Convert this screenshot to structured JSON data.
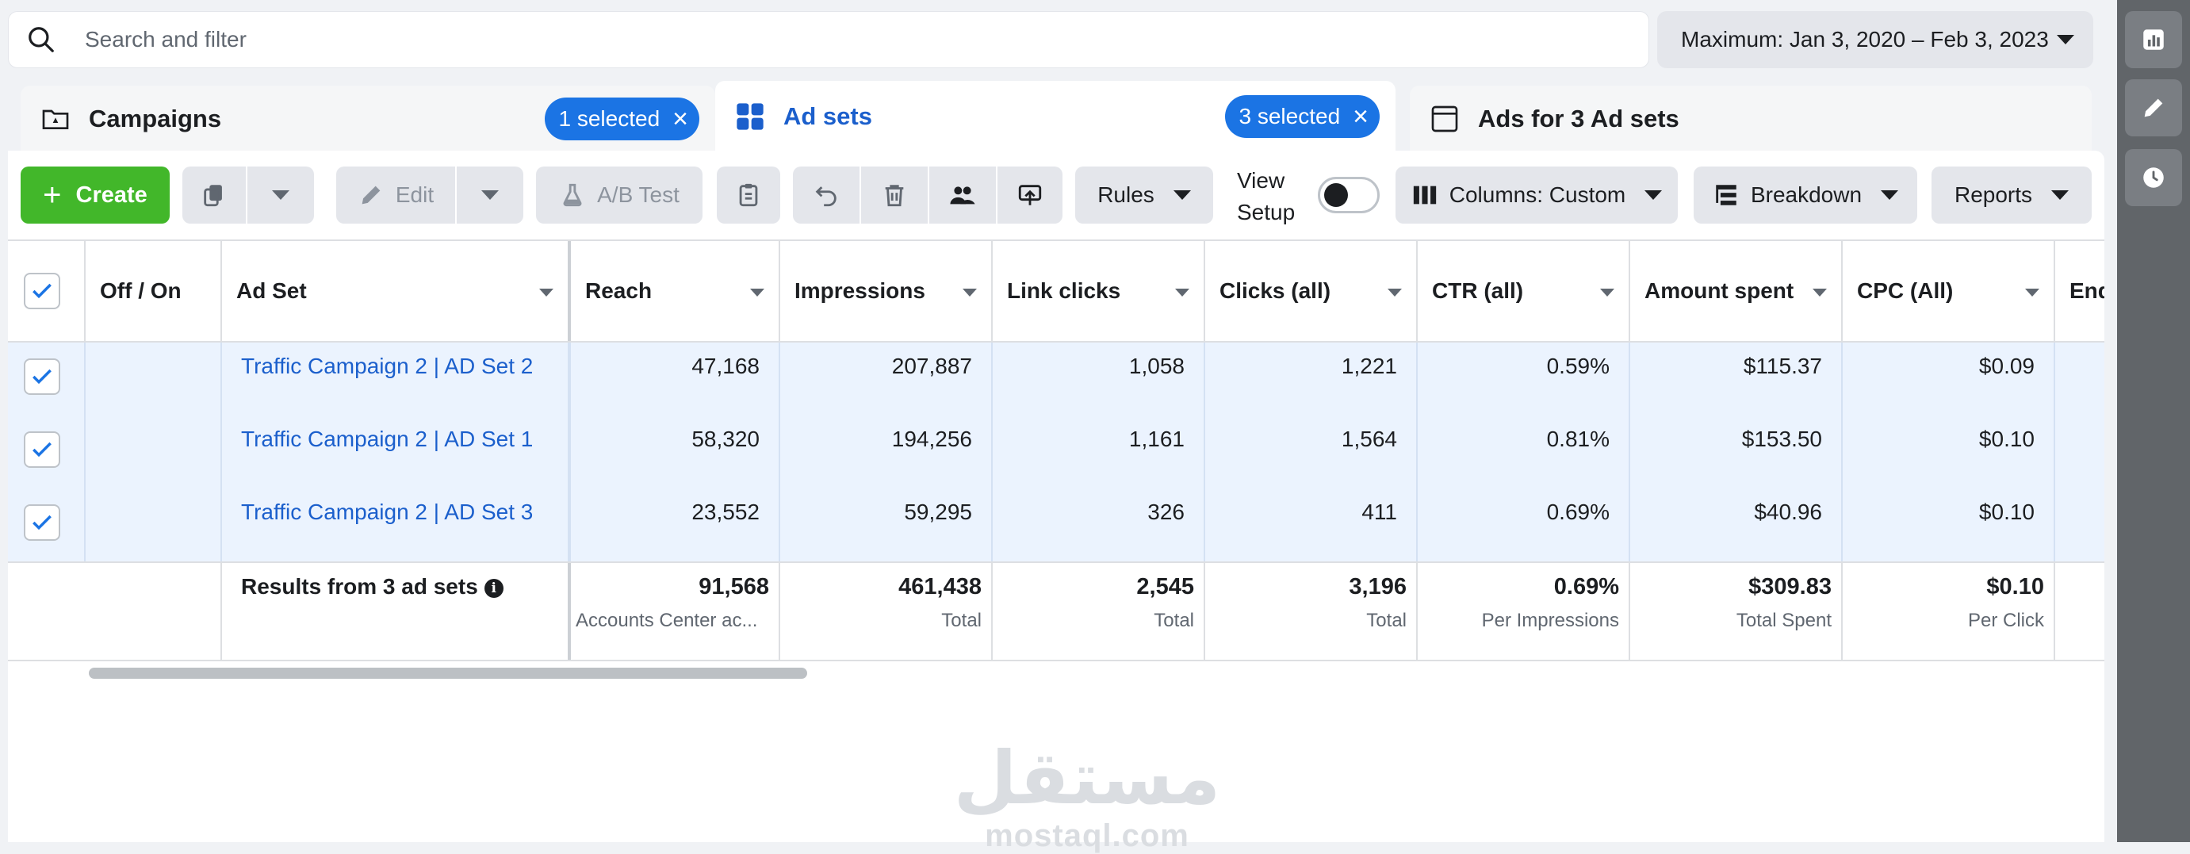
{
  "search": {
    "placeholder": "Search and filter"
  },
  "date_range": {
    "label": "Maximum: Jan 3, 2020 – Feb 3, 2023"
  },
  "tabs": [
    {
      "label": "Campaigns",
      "selected": "1 selected"
    },
    {
      "label": "Ad sets",
      "selected": "3 selected"
    },
    {
      "label": "Ads for 3 Ad sets"
    }
  ],
  "toolbar": {
    "create": "Create",
    "edit": "Edit",
    "ab_test": "A/B Test",
    "rules": "Rules",
    "view_setup_line1": "View",
    "view_setup_line2": "Setup",
    "columns": "Columns: Custom",
    "breakdown": "Breakdown",
    "reports": "Reports"
  },
  "table": {
    "columns": [
      "Off / On",
      "Ad Set",
      "Reach",
      "Impressions",
      "Link clicks",
      "Clicks (all)",
      "CTR (all)",
      "Amount spent",
      "CPC (All)",
      "Ends"
    ],
    "rows": [
      {
        "name": "Traffic Campaign 2 | AD Set 2",
        "reach": "47,168",
        "impressions": "207,887",
        "link_clicks": "1,058",
        "clicks_all": "1,221",
        "ctr": "0.59%",
        "spent": "$115.37",
        "cpc": "$0.09"
      },
      {
        "name": "Traffic Campaign 2 | AD Set 1",
        "reach": "58,320",
        "impressions": "194,256",
        "link_clicks": "1,161",
        "clicks_all": "1,564",
        "ctr": "0.81%",
        "spent": "$153.50",
        "cpc": "$0.10"
      },
      {
        "name": "Traffic Campaign 2 | AD Set 3",
        "reach": "23,552",
        "impressions": "59,295",
        "link_clicks": "326",
        "clicks_all": "411",
        "ctr": "0.69%",
        "spent": "$40.96",
        "cpc": "$0.10"
      }
    ],
    "totals": {
      "label": "Results from 3 ad sets",
      "reach": "91,568",
      "reach_sub": "Accounts Center ac...",
      "impressions": "461,438",
      "impressions_sub": "Total",
      "link_clicks": "2,545",
      "link_clicks_sub": "Total",
      "clicks_all": "3,196",
      "clicks_all_sub": "Total",
      "ctr": "0.69%",
      "ctr_sub": "Per Impressions",
      "spent": "$309.83",
      "spent_sub": "Total Spent",
      "cpc": "$0.10",
      "cpc_sub": "Per Click"
    }
  },
  "watermark": {
    "arabic": "مستقل",
    "latin": "mostaql.com"
  },
  "colors": {
    "accent": "#1b74e4",
    "create": "#42b72a",
    "row_selected": "#ebf3fe",
    "link": "#1b5fcc"
  },
  "icons": [
    "search-icon",
    "chart-icon",
    "pencil-icon",
    "clock-icon",
    "folder-icon",
    "grid-icon",
    "ad-frame-icon",
    "duplicate-icon",
    "pencil-icon",
    "beaker-icon",
    "clipboard-icon",
    "undo-icon",
    "trash-icon",
    "people-icon",
    "share-icon",
    "columns-icon",
    "breakdown-icon",
    "checkmark-icon",
    "info-icon"
  ]
}
